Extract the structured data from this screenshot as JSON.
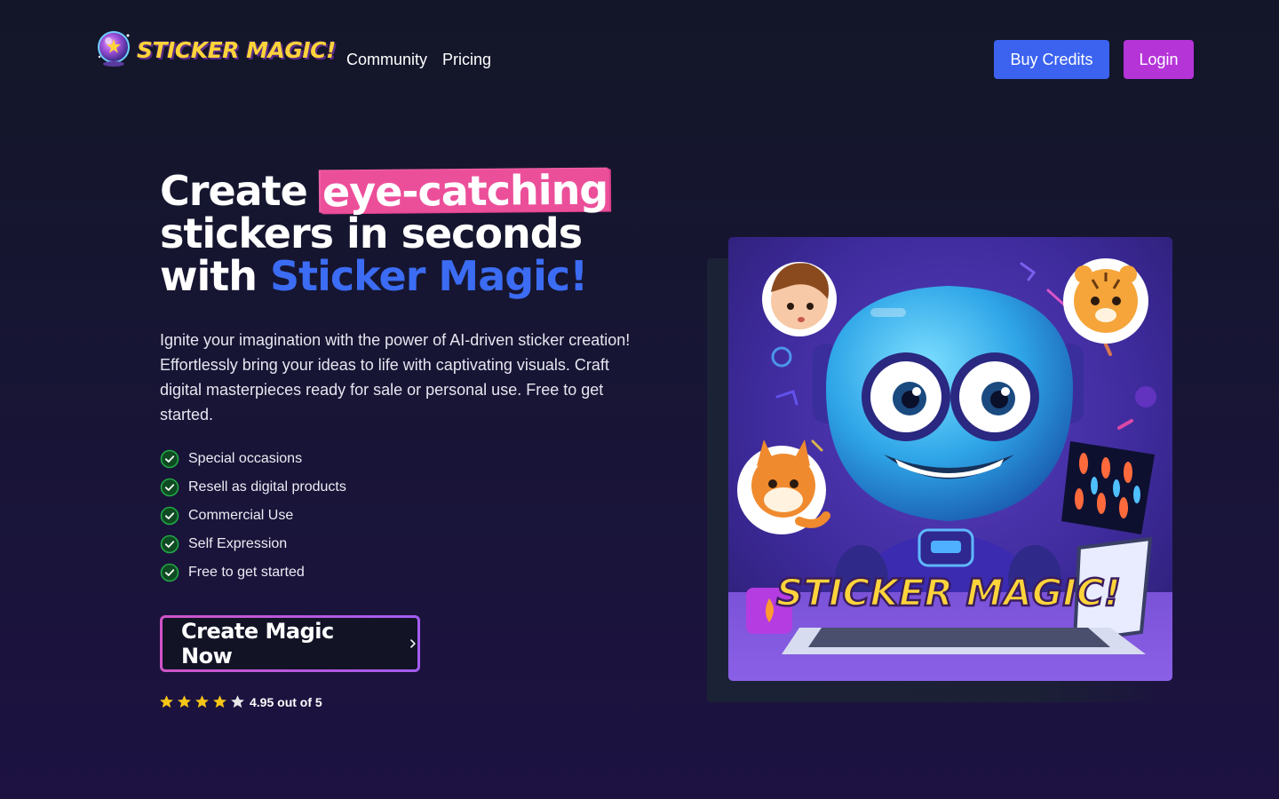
{
  "header": {
    "logo_text": "STICKER MAGIC!",
    "nav": [
      {
        "label": "Community"
      },
      {
        "label": "Pricing"
      }
    ],
    "buy_credits_label": "Buy Credits",
    "login_label": "Login"
  },
  "hero": {
    "title_part1": "Create ",
    "title_highlight": "eye-catching",
    "title_part2": " stickers in seconds with ",
    "title_brand": "Sticker Magic!",
    "description": "Ignite your imagination with the power of AI-driven sticker creation! Effortlessly bring your ideas to life with captivating visuals. Craft digital masterpieces ready for sale or personal use. Free to get started.",
    "features": [
      {
        "label": "Special occasions",
        "icon": "check-circle-icon"
      },
      {
        "label": "Resell as digital products",
        "icon": "check-circle-icon"
      },
      {
        "label": "Commercial Use",
        "icon": "check-circle-icon"
      },
      {
        "label": "Self Expression",
        "icon": "check-circle-icon"
      },
      {
        "label": "Free to get started",
        "icon": "check-circle-icon"
      }
    ],
    "cta_label": "Create Magic Now",
    "rating": {
      "stars": 5,
      "text": "4.95 out of 5"
    },
    "image_caption": "STICKER MAGIC!"
  },
  "colors": {
    "background": "#151730",
    "buy_credits": "#3b63f0",
    "login": "#b534d8",
    "highlight": "#ec4f9a",
    "brand_blue": "#3b6cf3",
    "check_green": "#22a845",
    "star": "#f5c518"
  }
}
